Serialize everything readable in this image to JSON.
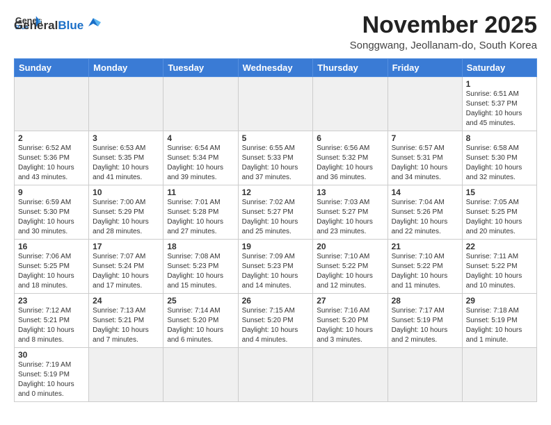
{
  "header": {
    "logo_general": "General",
    "logo_blue": "Blue",
    "month_title": "November 2025",
    "location": "Songgwang, Jeollanam-do, South Korea"
  },
  "weekdays": [
    "Sunday",
    "Monday",
    "Tuesday",
    "Wednesday",
    "Thursday",
    "Friday",
    "Saturday"
  ],
  "weeks": [
    [
      {
        "num": "",
        "info": ""
      },
      {
        "num": "",
        "info": ""
      },
      {
        "num": "",
        "info": ""
      },
      {
        "num": "",
        "info": ""
      },
      {
        "num": "",
        "info": ""
      },
      {
        "num": "",
        "info": ""
      },
      {
        "num": "1",
        "info": "Sunrise: 6:51 AM\nSunset: 5:37 PM\nDaylight: 10 hours and 45 minutes."
      }
    ],
    [
      {
        "num": "2",
        "info": "Sunrise: 6:52 AM\nSunset: 5:36 PM\nDaylight: 10 hours and 43 minutes."
      },
      {
        "num": "3",
        "info": "Sunrise: 6:53 AM\nSunset: 5:35 PM\nDaylight: 10 hours and 41 minutes."
      },
      {
        "num": "4",
        "info": "Sunrise: 6:54 AM\nSunset: 5:34 PM\nDaylight: 10 hours and 39 minutes."
      },
      {
        "num": "5",
        "info": "Sunrise: 6:55 AM\nSunset: 5:33 PM\nDaylight: 10 hours and 37 minutes."
      },
      {
        "num": "6",
        "info": "Sunrise: 6:56 AM\nSunset: 5:32 PM\nDaylight: 10 hours and 36 minutes."
      },
      {
        "num": "7",
        "info": "Sunrise: 6:57 AM\nSunset: 5:31 PM\nDaylight: 10 hours and 34 minutes."
      },
      {
        "num": "8",
        "info": "Sunrise: 6:58 AM\nSunset: 5:30 PM\nDaylight: 10 hours and 32 minutes."
      }
    ],
    [
      {
        "num": "9",
        "info": "Sunrise: 6:59 AM\nSunset: 5:30 PM\nDaylight: 10 hours and 30 minutes."
      },
      {
        "num": "10",
        "info": "Sunrise: 7:00 AM\nSunset: 5:29 PM\nDaylight: 10 hours and 28 minutes."
      },
      {
        "num": "11",
        "info": "Sunrise: 7:01 AM\nSunset: 5:28 PM\nDaylight: 10 hours and 27 minutes."
      },
      {
        "num": "12",
        "info": "Sunrise: 7:02 AM\nSunset: 5:27 PM\nDaylight: 10 hours and 25 minutes."
      },
      {
        "num": "13",
        "info": "Sunrise: 7:03 AM\nSunset: 5:27 PM\nDaylight: 10 hours and 23 minutes."
      },
      {
        "num": "14",
        "info": "Sunrise: 7:04 AM\nSunset: 5:26 PM\nDaylight: 10 hours and 22 minutes."
      },
      {
        "num": "15",
        "info": "Sunrise: 7:05 AM\nSunset: 5:25 PM\nDaylight: 10 hours and 20 minutes."
      }
    ],
    [
      {
        "num": "16",
        "info": "Sunrise: 7:06 AM\nSunset: 5:25 PM\nDaylight: 10 hours and 18 minutes."
      },
      {
        "num": "17",
        "info": "Sunrise: 7:07 AM\nSunset: 5:24 PM\nDaylight: 10 hours and 17 minutes."
      },
      {
        "num": "18",
        "info": "Sunrise: 7:08 AM\nSunset: 5:23 PM\nDaylight: 10 hours and 15 minutes."
      },
      {
        "num": "19",
        "info": "Sunrise: 7:09 AM\nSunset: 5:23 PM\nDaylight: 10 hours and 14 minutes."
      },
      {
        "num": "20",
        "info": "Sunrise: 7:10 AM\nSunset: 5:22 PM\nDaylight: 10 hours and 12 minutes."
      },
      {
        "num": "21",
        "info": "Sunrise: 7:10 AM\nSunset: 5:22 PM\nDaylight: 10 hours and 11 minutes."
      },
      {
        "num": "22",
        "info": "Sunrise: 7:11 AM\nSunset: 5:22 PM\nDaylight: 10 hours and 10 minutes."
      }
    ],
    [
      {
        "num": "23",
        "info": "Sunrise: 7:12 AM\nSunset: 5:21 PM\nDaylight: 10 hours and 8 minutes."
      },
      {
        "num": "24",
        "info": "Sunrise: 7:13 AM\nSunset: 5:21 PM\nDaylight: 10 hours and 7 minutes."
      },
      {
        "num": "25",
        "info": "Sunrise: 7:14 AM\nSunset: 5:20 PM\nDaylight: 10 hours and 6 minutes."
      },
      {
        "num": "26",
        "info": "Sunrise: 7:15 AM\nSunset: 5:20 PM\nDaylight: 10 hours and 4 minutes."
      },
      {
        "num": "27",
        "info": "Sunrise: 7:16 AM\nSunset: 5:20 PM\nDaylight: 10 hours and 3 minutes."
      },
      {
        "num": "28",
        "info": "Sunrise: 7:17 AM\nSunset: 5:19 PM\nDaylight: 10 hours and 2 minutes."
      },
      {
        "num": "29",
        "info": "Sunrise: 7:18 AM\nSunset: 5:19 PM\nDaylight: 10 hours and 1 minute."
      }
    ],
    [
      {
        "num": "30",
        "info": "Sunrise: 7:19 AM\nSunset: 5:19 PM\nDaylight: 10 hours and 0 minutes."
      },
      {
        "num": "",
        "info": ""
      },
      {
        "num": "",
        "info": ""
      },
      {
        "num": "",
        "info": ""
      },
      {
        "num": "",
        "info": ""
      },
      {
        "num": "",
        "info": ""
      },
      {
        "num": "",
        "info": ""
      }
    ]
  ]
}
